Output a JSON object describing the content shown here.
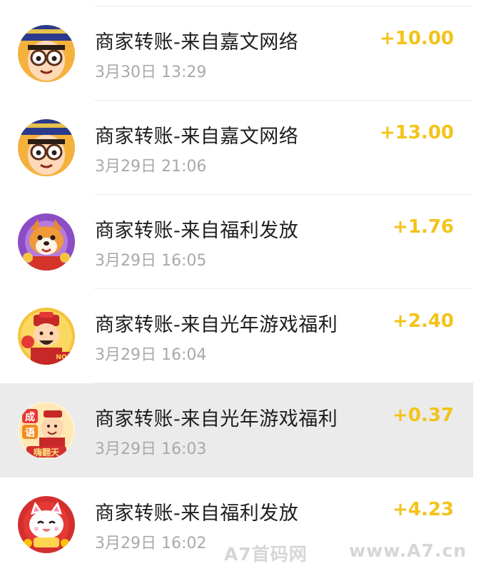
{
  "transactions": [
    {
      "title": "商家转账-来自嘉文网络",
      "time": "3月30日 13:29",
      "amount": "+10.00",
      "avatar_icon": "emperor-avatar-icon"
    },
    {
      "title": "商家转账-来自嘉文网络",
      "time": "3月29日 21:06",
      "amount": "+13.00",
      "avatar_icon": "emperor-avatar-icon"
    },
    {
      "title": "商家转账-来自福利发放",
      "time": "3月29日 16:05",
      "amount": "+1.76",
      "avatar_icon": "shiba-dog-avatar-icon"
    },
    {
      "title": "商家转账-来自光年游戏福利",
      "time": "3月29日 16:04",
      "amount": "+2.40",
      "avatar_icon": "god-of-wealth-avatar-icon"
    },
    {
      "title": "商家转账-来自光年游戏福利",
      "time": "3月29日 16:03",
      "amount": "+0.37",
      "avatar_icon": "idiom-game-avatar-icon"
    },
    {
      "title": "商家转账-来自福利发放",
      "time": "3月29日 16:02",
      "amount": "+4.23",
      "avatar_icon": "lucky-cat-avatar-icon"
    }
  ],
  "avatar_text": {
    "idiom_top": "成",
    "idiom_mid": "语",
    "idiom_bottom": "嗨翻天",
    "wealth_badge": "NO"
  },
  "watermark": {
    "left": "A7首码网",
    "right": "www.A7.cn"
  },
  "colors": {
    "amount": "#f3c319",
    "title": "#1d1d1d",
    "time": "#a9a9a9",
    "highlight_row": "#ebebeb"
  }
}
